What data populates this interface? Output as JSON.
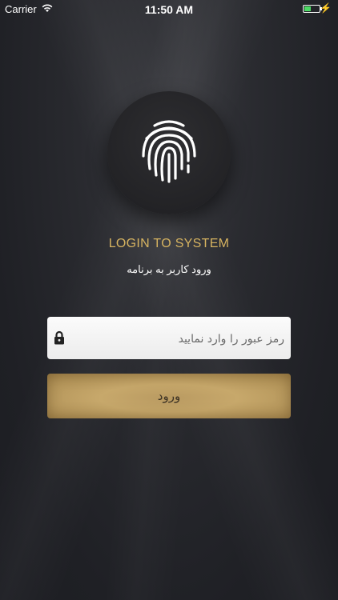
{
  "status_bar": {
    "carrier": "Carrier",
    "time": "11:50 AM",
    "battery_level": 0.45
  },
  "header": {
    "title": "LOGIN TO SYSTEM",
    "subtitle": "ورود کاربر به برنامه"
  },
  "form": {
    "password_placeholder": "رمز عبور را وارد نمایید",
    "password_value": "",
    "login_label": "ورود"
  },
  "icons": {
    "fingerprint": "fingerprint-icon",
    "lock": "lock-icon",
    "wifi": "wifi-icon",
    "battery": "battery-icon",
    "charge": "charging-bolt-icon"
  },
  "colors": {
    "accent_gold": "#d6b360",
    "button_gold": "#c7a86b",
    "background": "#232429"
  }
}
